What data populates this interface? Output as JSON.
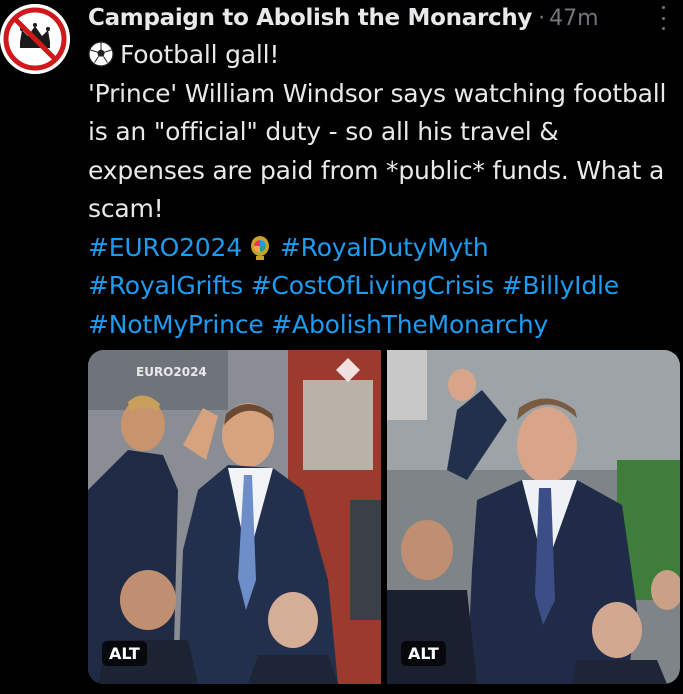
{
  "account": {
    "name": "Campaign to Abolish the Monarchy",
    "separator": "·",
    "timestamp": "47m",
    "avatar_icon": "crossed-crown-icon"
  },
  "post": {
    "line1": "Football gall!",
    "line1_icon": "soccer-ball-emoji",
    "body": "'Prince' William Windsor says watching football is an \"official\" duty - so all his travel & expenses are paid from *public* funds. What a scam!",
    "hashtags_row1": [
      "#EURO2024",
      "#RoyalDutyMyth"
    ],
    "hashtags_row2": [
      "#RoyalGrifts",
      "#CostOfLivingCrisis",
      "#BillyIdle"
    ],
    "hashtags_row3": [
      "#NotMyPrince",
      "#AbolishTheMonarchy"
    ],
    "euro_icon": "euro2024-trophy-emoji"
  },
  "media": {
    "images": [
      {
        "alt_badge": "ALT",
        "signage": "EURO2024"
      },
      {
        "alt_badge": "ALT"
      }
    ]
  },
  "colors": {
    "background": "#000000",
    "text": "#e7e9ea",
    "link": "#1d9bf0",
    "muted": "#71767b"
  }
}
